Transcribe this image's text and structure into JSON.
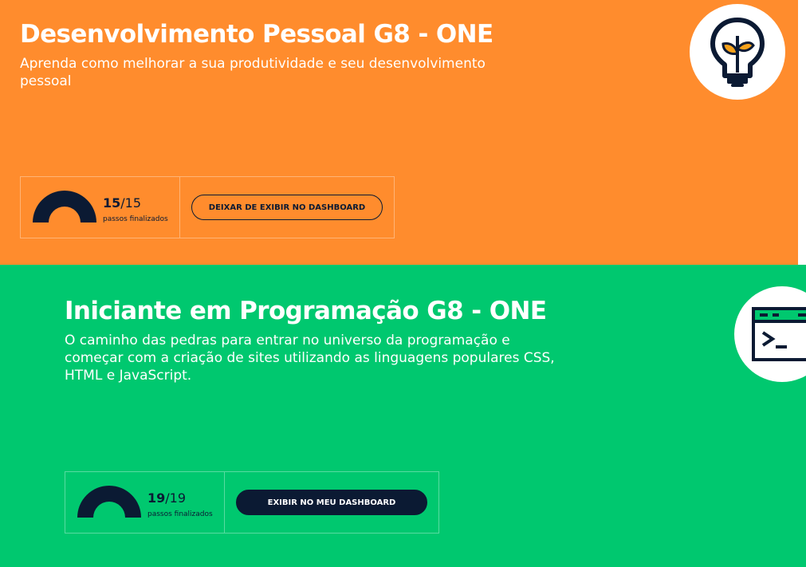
{
  "courses": [
    {
      "title": "Desenvolvimento Pessoal G8 - ONE",
      "description": "Aprenda como melhorar a sua produtividade e seu desenvolvimento pessoal",
      "progress": {
        "done": "15",
        "total": "/15",
        "label": "passos finalizados",
        "fraction": 1.0
      },
      "button_label": "DEIXAR DE EXIBIR NO DASHBOARD",
      "icon": "lightbulb-plant-icon",
      "color": "#ff8c2d"
    },
    {
      "title": "Iniciante em Programação G8 - ONE",
      "description": "O caminho das pedras para entrar no universo da programação e começar com a criação de sites utilizando as linguagens populares CSS, HTML e JavaScript.",
      "progress": {
        "done": "19",
        "total": "/19",
        "label": "passos finalizados",
        "fraction": 1.0
      },
      "button_label": "EXIBIR NO MEU DASHBOARD",
      "icon": "terminal-window-icon",
      "color": "#00c86f"
    }
  ],
  "colors": {
    "dark": "#0b1a33",
    "white": "#ffffff"
  }
}
